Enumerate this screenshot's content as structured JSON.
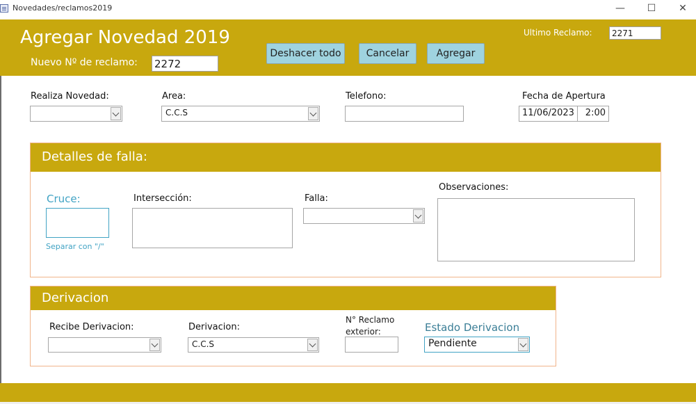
{
  "window": {
    "title": "Novedades/reclamos2019",
    "min_symbol": "—",
    "max_symbol": "☐",
    "close_symbol": "✕"
  },
  "header": {
    "title": "Agregar Novedad 2019",
    "nuevo_label": "Nuevo Nº de reclamo:",
    "nuevo_value": "2272",
    "ultimo_label": "Ultimo Reclamo:",
    "ultimo_value": "2271",
    "buttons": {
      "deshacer": "Deshacer todo",
      "cancelar": "Cancelar",
      "agregar": "Agregar"
    }
  },
  "top_fields": {
    "realiza_label": "Realiza Novedad:",
    "realiza_value": "",
    "area_label": "Area:",
    "area_value": "C.C.S",
    "telefono_label": "Telefono:",
    "telefono_value": "",
    "fecha_label": "Fecha de Apertura",
    "fecha_value": "11/06/2023",
    "hora_value": "2:00"
  },
  "detalles": {
    "title": "Detalles de falla:",
    "cruce_label": "Cruce:",
    "cruce_value": "",
    "cruce_hint": "Separar con \"/\"",
    "interseccion_label": "Intersección:",
    "interseccion_value": "",
    "falla_label": "Falla:",
    "falla_value": "",
    "observaciones_label": "Observaciones:",
    "observaciones_value": ""
  },
  "derivacion": {
    "title": "Derivacion",
    "recibe_label": "Recibe Derivacion:",
    "recibe_value": "",
    "derivacion_label": "Derivacion:",
    "derivacion_value": "C.C.S",
    "reclamo_ext_label_1": "N° Reclamo",
    "reclamo_ext_label_2": "exterior:",
    "reclamo_ext_value": "",
    "estado_label": "Estado Derivacion",
    "estado_value": "Pendiente"
  },
  "colors": {
    "band": "#c8a80e",
    "button": "#9fd3df",
    "section_border": "#f0b48a",
    "accent_text": "#41a3c4",
    "estado_label": "#3a7e96"
  }
}
